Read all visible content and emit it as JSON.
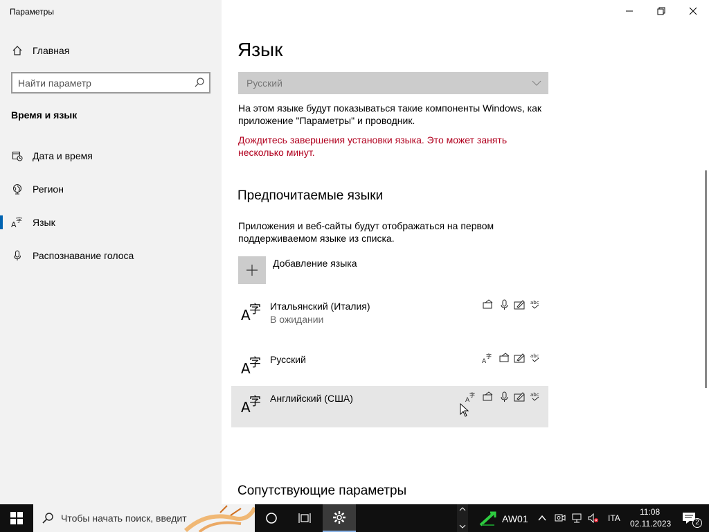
{
  "window": {
    "title": "Параметры",
    "controls": {
      "minimize": "minimize",
      "restore": "restore",
      "close": "close"
    }
  },
  "sidebar": {
    "home_label": "Главная",
    "search_placeholder": "Найти параметр",
    "section_title": "Время и язык",
    "items": [
      {
        "label": "Дата и время",
        "icon": "calendar-clock-icon",
        "active": false
      },
      {
        "label": "Регион",
        "icon": "globe-icon",
        "active": false
      },
      {
        "label": "Язык",
        "icon": "language-icon",
        "active": true
      },
      {
        "label": "Распознавание голоса",
        "icon": "microphone-icon",
        "active": false
      }
    ]
  },
  "main": {
    "title": "Язык",
    "display_language": {
      "selected": "Русский",
      "description": "На этом языке будут показываться такие компоненты Windows, как приложение \"Параметры\" и проводник.",
      "warning": "Дождитесь завершения установки языка. Это может занять несколько минут."
    },
    "preferred": {
      "heading": "Предпочитаемые языки",
      "description": "Приложения и веб-сайты будут отображаться на первом поддерживаемом языке из списка.",
      "add_label": "Добавление языка",
      "languages": [
        {
          "name": "Итальянский (Италия)",
          "status": "В ожидании",
          "features": [
            "display",
            "speech",
            "handwriting",
            "spelling"
          ]
        },
        {
          "name": "Русский",
          "status": "",
          "features": [
            "language-pack",
            "display",
            "handwriting",
            "spelling"
          ]
        },
        {
          "name": "Английский (США)",
          "status": "",
          "features": [
            "language-pack",
            "display",
            "speech",
            "handwriting",
            "spelling"
          ]
        }
      ]
    },
    "related_heading": "Сопутствующие параметры"
  },
  "taskbar": {
    "search_text": "Чтобы начать поиск, введит",
    "tray": {
      "network_label": "AW01",
      "language": "ITA",
      "time": "11:08",
      "date": "02.11.2023",
      "notifications_count": "2"
    }
  },
  "colors": {
    "accent": "#0063b1",
    "warning": "#b1001e",
    "sidebar_bg": "#f2f2f2",
    "taskbar_bg": "#101010"
  }
}
